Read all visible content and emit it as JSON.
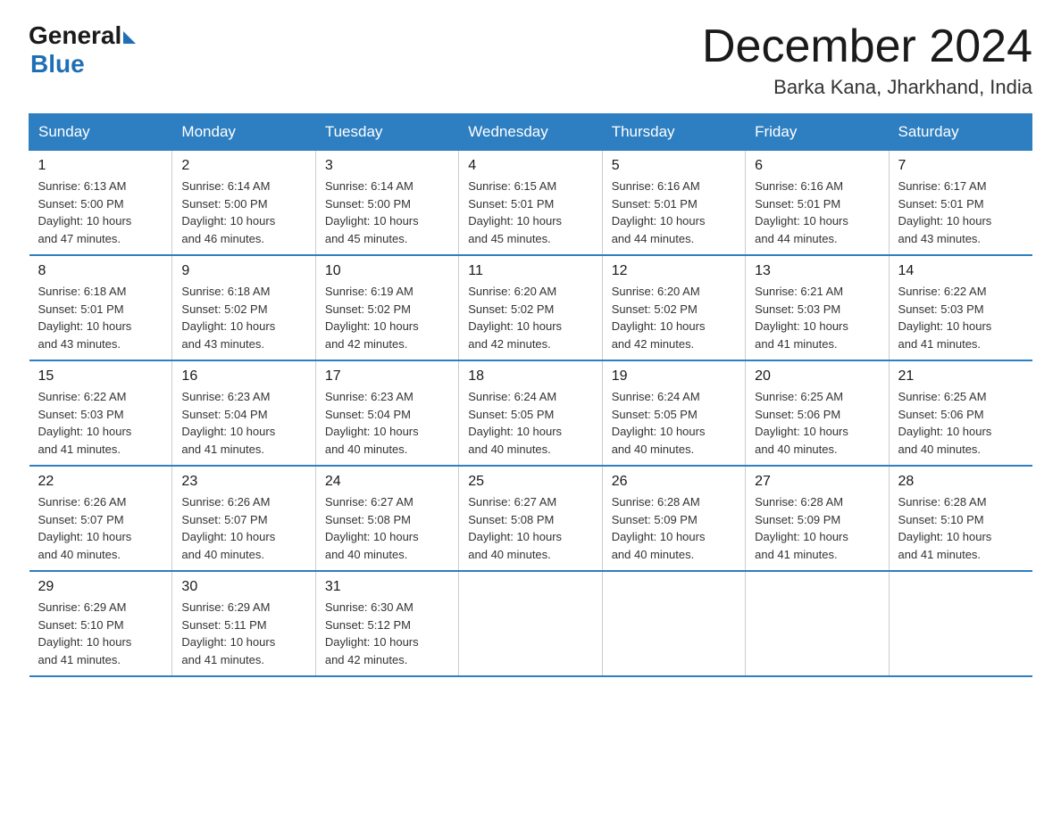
{
  "logo": {
    "general": "General",
    "blue": "Blue",
    "sub": "Blue"
  },
  "header": {
    "title": "December 2024",
    "location": "Barka Kana, Jharkhand, India"
  },
  "weekdays": [
    "Sunday",
    "Monday",
    "Tuesday",
    "Wednesday",
    "Thursday",
    "Friday",
    "Saturday"
  ],
  "weeks": [
    [
      {
        "day": "1",
        "sunrise": "6:13 AM",
        "sunset": "5:00 PM",
        "daylight": "10 hours and 47 minutes."
      },
      {
        "day": "2",
        "sunrise": "6:14 AM",
        "sunset": "5:00 PM",
        "daylight": "10 hours and 46 minutes."
      },
      {
        "day": "3",
        "sunrise": "6:14 AM",
        "sunset": "5:00 PM",
        "daylight": "10 hours and 45 minutes."
      },
      {
        "day": "4",
        "sunrise": "6:15 AM",
        "sunset": "5:01 PM",
        "daylight": "10 hours and 45 minutes."
      },
      {
        "day": "5",
        "sunrise": "6:16 AM",
        "sunset": "5:01 PM",
        "daylight": "10 hours and 44 minutes."
      },
      {
        "day": "6",
        "sunrise": "6:16 AM",
        "sunset": "5:01 PM",
        "daylight": "10 hours and 44 minutes."
      },
      {
        "day": "7",
        "sunrise": "6:17 AM",
        "sunset": "5:01 PM",
        "daylight": "10 hours and 43 minutes."
      }
    ],
    [
      {
        "day": "8",
        "sunrise": "6:18 AM",
        "sunset": "5:01 PM",
        "daylight": "10 hours and 43 minutes."
      },
      {
        "day": "9",
        "sunrise": "6:18 AM",
        "sunset": "5:02 PM",
        "daylight": "10 hours and 43 minutes."
      },
      {
        "day": "10",
        "sunrise": "6:19 AM",
        "sunset": "5:02 PM",
        "daylight": "10 hours and 42 minutes."
      },
      {
        "day": "11",
        "sunrise": "6:20 AM",
        "sunset": "5:02 PM",
        "daylight": "10 hours and 42 minutes."
      },
      {
        "day": "12",
        "sunrise": "6:20 AM",
        "sunset": "5:02 PM",
        "daylight": "10 hours and 42 minutes."
      },
      {
        "day": "13",
        "sunrise": "6:21 AM",
        "sunset": "5:03 PM",
        "daylight": "10 hours and 41 minutes."
      },
      {
        "day": "14",
        "sunrise": "6:22 AM",
        "sunset": "5:03 PM",
        "daylight": "10 hours and 41 minutes."
      }
    ],
    [
      {
        "day": "15",
        "sunrise": "6:22 AM",
        "sunset": "5:03 PM",
        "daylight": "10 hours and 41 minutes."
      },
      {
        "day": "16",
        "sunrise": "6:23 AM",
        "sunset": "5:04 PM",
        "daylight": "10 hours and 41 minutes."
      },
      {
        "day": "17",
        "sunrise": "6:23 AM",
        "sunset": "5:04 PM",
        "daylight": "10 hours and 40 minutes."
      },
      {
        "day": "18",
        "sunrise": "6:24 AM",
        "sunset": "5:05 PM",
        "daylight": "10 hours and 40 minutes."
      },
      {
        "day": "19",
        "sunrise": "6:24 AM",
        "sunset": "5:05 PM",
        "daylight": "10 hours and 40 minutes."
      },
      {
        "day": "20",
        "sunrise": "6:25 AM",
        "sunset": "5:06 PM",
        "daylight": "10 hours and 40 minutes."
      },
      {
        "day": "21",
        "sunrise": "6:25 AM",
        "sunset": "5:06 PM",
        "daylight": "10 hours and 40 minutes."
      }
    ],
    [
      {
        "day": "22",
        "sunrise": "6:26 AM",
        "sunset": "5:07 PM",
        "daylight": "10 hours and 40 minutes."
      },
      {
        "day": "23",
        "sunrise": "6:26 AM",
        "sunset": "5:07 PM",
        "daylight": "10 hours and 40 minutes."
      },
      {
        "day": "24",
        "sunrise": "6:27 AM",
        "sunset": "5:08 PM",
        "daylight": "10 hours and 40 minutes."
      },
      {
        "day": "25",
        "sunrise": "6:27 AM",
        "sunset": "5:08 PM",
        "daylight": "10 hours and 40 minutes."
      },
      {
        "day": "26",
        "sunrise": "6:28 AM",
        "sunset": "5:09 PM",
        "daylight": "10 hours and 40 minutes."
      },
      {
        "day": "27",
        "sunrise": "6:28 AM",
        "sunset": "5:09 PM",
        "daylight": "10 hours and 41 minutes."
      },
      {
        "day": "28",
        "sunrise": "6:28 AM",
        "sunset": "5:10 PM",
        "daylight": "10 hours and 41 minutes."
      }
    ],
    [
      {
        "day": "29",
        "sunrise": "6:29 AM",
        "sunset": "5:10 PM",
        "daylight": "10 hours and 41 minutes."
      },
      {
        "day": "30",
        "sunrise": "6:29 AM",
        "sunset": "5:11 PM",
        "daylight": "10 hours and 41 minutes."
      },
      {
        "day": "31",
        "sunrise": "6:30 AM",
        "sunset": "5:12 PM",
        "daylight": "10 hours and 42 minutes."
      },
      null,
      null,
      null,
      null
    ]
  ],
  "labels": {
    "sunrise": "Sunrise:",
    "sunset": "Sunset:",
    "daylight": "Daylight:"
  }
}
